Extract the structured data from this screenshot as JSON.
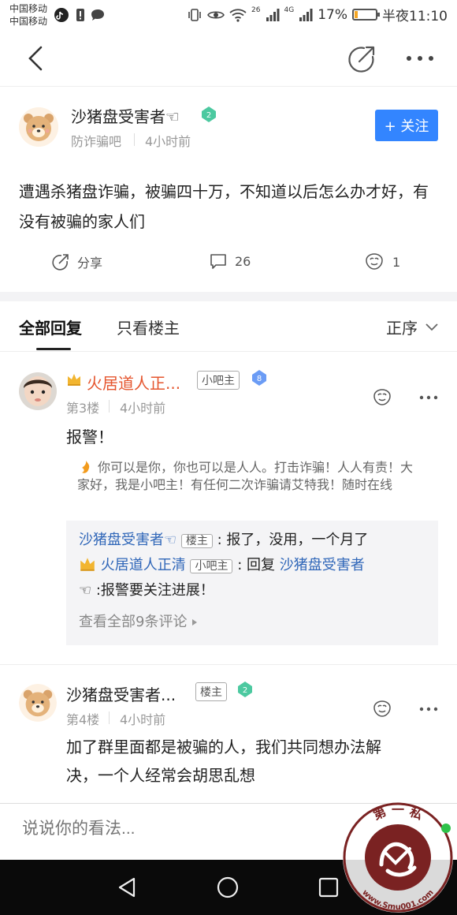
{
  "status_bar": {
    "carrier_1": "中国移动",
    "carrier_2": "中国移动",
    "network_1": "26",
    "network_2": "4G",
    "battery_text": "17%",
    "battery_level": 0.17,
    "time": "半夜11:10"
  },
  "nav": {
    "back_icon": "chevron-left-icon",
    "share_icon": "share-arrow-icon",
    "more_icon": "more-dots-icon"
  },
  "post": {
    "author": "沙猪盘受害者☜",
    "level": "2",
    "forum": "防诈骗吧",
    "time": "4小时前",
    "follow_label": "+ 关注",
    "content": "遭遇杀猪盘诈骗，被骗四十万，不知道以后怎么办才好，有没有被骗的家人们",
    "share_label": "分享",
    "comment_count": "26",
    "like_count": "1"
  },
  "tabs": {
    "all_replies": "全部回复",
    "op_only": "只看楼主",
    "sort_label": "正序"
  },
  "replies": [
    {
      "name": "火居道人正...",
      "tag": "小吧主",
      "level": "8",
      "floor": "第3楼",
      "time": "4小时前",
      "body": "报警！",
      "signature": "你可以是你，你也可以是人人。打击诈骗！人人有责！大家好，我是小吧主！有任何二次诈骗请艾特我！随时在线",
      "sub_replies": [
        {
          "name": "沙猪盘受害者☜",
          "tag": "楼主",
          "text": ": 报了，没用，一个月了"
        },
        {
          "name": "火居道人正清",
          "tag": "小吧主",
          "text_prefix": ": 回复 ",
          "reply_to": "沙猪盘受害者",
          "text_cont": "☜ :报警要关注进展！"
        }
      ],
      "view_all": "查看全部9条评论"
    },
    {
      "name": "沙猪盘受害者...",
      "tag": "楼主",
      "level": "2",
      "floor": "第4楼",
      "time": "4小时前",
      "body_line1": "加了群里面都是被骗的人，我们共同想办法解",
      "body_line2": "决，一个人经常会胡思乱想"
    }
  ],
  "comment_bar": {
    "placeholder": "说说你的看法..."
  },
  "watermark": {
    "text_top": "第 一 私",
    "text_bottom": "www.Smu001.com"
  },
  "colors": {
    "accent_blue": "#3385ff",
    "link_blue": "#2f66b8",
    "orange_name": "#e5552e",
    "watermark_red": "#7a2222"
  }
}
